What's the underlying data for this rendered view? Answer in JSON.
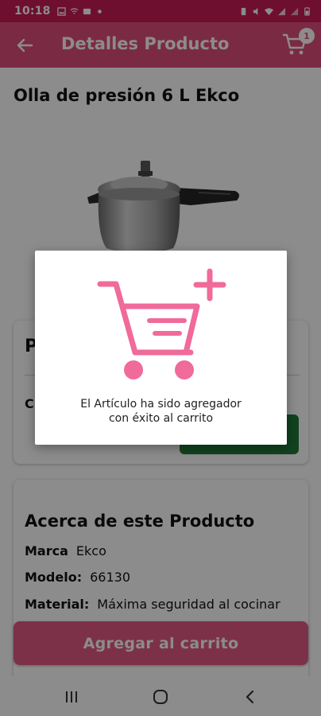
{
  "status_bar": {
    "time": "10:18"
  },
  "app_bar": {
    "title": "Detalles Producto",
    "cart_count": "1"
  },
  "product": {
    "title": "Olla de presión 6 L Ekco",
    "price_heading_partial": "P",
    "quantity_label_partial": "C"
  },
  "about": {
    "heading": "Acerca de este Producto",
    "specs": [
      {
        "label": "Marca",
        "value": "Ekco"
      },
      {
        "label": "Modelo:",
        "value": "66130"
      },
      {
        "label": "Material:",
        "value": "Máxima seguridad al cocinar"
      }
    ]
  },
  "actions": {
    "add_to_cart": "Agregar al carrito"
  },
  "dialog": {
    "message_line1": "El Artículo ha sido agregador",
    "message_line2": "con éxito al carrito"
  },
  "colors": {
    "primary": "#e14d7d",
    "status_bar": "#c81d57",
    "accent_icon": "#f06a9a",
    "buy_green": "#1f7a3a"
  },
  "icons": {
    "back": "arrow-left-icon",
    "cart": "shopping-cart-icon",
    "dialog": "cart-add-icon"
  }
}
